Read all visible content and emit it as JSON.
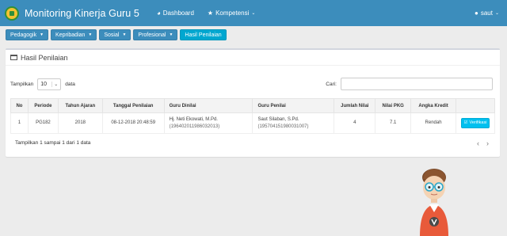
{
  "navbar": {
    "title": "Monitoring Kinerja Guru 5",
    "links": [
      {
        "label": "Dashboard",
        "icon": "dashboard-icon"
      },
      {
        "label": "Kompetensi",
        "icon": "star-icon"
      }
    ],
    "user": "saut"
  },
  "submenu": [
    {
      "label": "Pedagogik"
    },
    {
      "label": "Kepribadian"
    },
    {
      "label": "Sosial"
    },
    {
      "label": "Profesional"
    },
    {
      "label": "Hasil Penilaian"
    }
  ],
  "box": {
    "title": "Hasil Penilaian",
    "length_prefix": "Tampilkan",
    "length_value": "10",
    "length_suffix": "data",
    "search_label": "Cari:",
    "search_value": ""
  },
  "table": {
    "headers": [
      "No",
      "Periode",
      "Tahun Ajaran",
      "Tanggal Penilaian",
      "Guru Dinilai",
      "Guru Penilai",
      "Jumlah Nilai",
      "Nilai PKG",
      "Angka Kredit",
      ""
    ],
    "rows": [
      {
        "no": "1",
        "periode": "PG182",
        "tahun": "2018",
        "tanggal": "08-12-2018 20:48:59",
        "dinilai_name": "Hj. Neti Ekowati, M.Pd.",
        "dinilai_nip": "(196402011986032013)",
        "penilai_name": "Saut Silaban, S.Pd.",
        "penilai_nip": "(195704151980031007)",
        "jumlah": "4",
        "pkg": "7.1",
        "kredit": "Rendah",
        "action": "Verifikasi"
      }
    ]
  },
  "footer": {
    "info": "Tampilkan 1 sampai 1 dari 1 data",
    "prev": "‹",
    "next": "›"
  },
  "colors": {
    "navbar": "#3c8dbc",
    "active_tab": "#00a7d0",
    "verify_button": "#00c0ef"
  }
}
